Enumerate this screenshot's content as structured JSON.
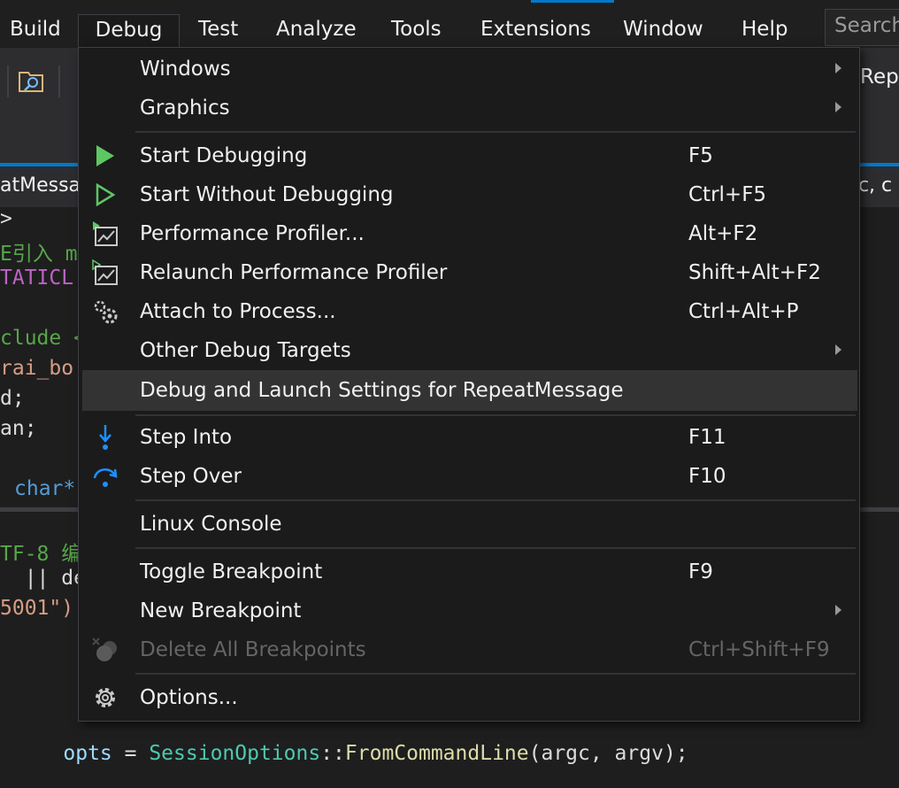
{
  "menubar": {
    "items": [
      "Build",
      "Debug",
      "Test",
      "Analyze",
      "Tools",
      "Extensions",
      "Window",
      "Help"
    ],
    "search_placeholder": "Search"
  },
  "toolbar": {
    "right_text": "Rep"
  },
  "tabs": {
    "active_label": "atMessa",
    "right_label": "gc, c"
  },
  "code": {
    "lines": [
      ">",
      "E引入 m",
      "TATICL",
      "",
      "clude <",
      "rai_bo",
      "d;",
      "an;",
      "",
      "char*"
    ],
    "lower_lines": [
      "TF-8 编",
      "  || de",
      "5001\")",
      "",
      "",
      ""
    ],
    "bottom_line": {
      "var": "opts",
      "op": " = ",
      "type": "SessionOptions",
      "sep": "::",
      "func": "FromCommandLine",
      "args": "(argc, argv);"
    }
  },
  "debug_menu": {
    "items": [
      {
        "label": "Windows",
        "shortcut": "",
        "submenu": true
      },
      {
        "label": "Graphics",
        "shortcut": "",
        "submenu": true
      },
      {
        "label": "Start Debugging",
        "shortcut": "F5",
        "icon": "play-filled-icon"
      },
      {
        "label": "Start Without Debugging",
        "shortcut": "Ctrl+F5",
        "icon": "play-outline-icon"
      },
      {
        "label": "Performance Profiler...",
        "shortcut": "Alt+F2",
        "icon": "performance-profiler-icon"
      },
      {
        "label": "Relaunch Performance Profiler",
        "shortcut": "Shift+Alt+F2",
        "icon": "relaunch-profiler-icon"
      },
      {
        "label": "Attach to Process...",
        "shortcut": "Ctrl+Alt+P",
        "icon": "gears-icon"
      },
      {
        "label": "Other Debug Targets",
        "shortcut": "",
        "submenu": true
      },
      {
        "label": "Debug and Launch Settings for RepeatMessage",
        "shortcut": ""
      },
      {
        "label": "Step Into",
        "shortcut": "F11",
        "icon": "step-into-icon"
      },
      {
        "label": "Step Over",
        "shortcut": "F10",
        "icon": "step-over-icon"
      },
      {
        "label": "Linux Console",
        "shortcut": ""
      },
      {
        "label": "Toggle Breakpoint",
        "shortcut": "F9"
      },
      {
        "label": "New Breakpoint",
        "shortcut": "",
        "submenu": true
      },
      {
        "label": "Delete All Breakpoints",
        "shortcut": "Ctrl+Shift+F9",
        "icon": "delete-breakpoints-icon",
        "disabled": true
      },
      {
        "label": "Options...",
        "shortcut": "",
        "icon": "gear-icon"
      }
    ]
  },
  "colors": {
    "accent": "#007acc",
    "play_green": "#5ec764",
    "step_blue": "#1e90ff",
    "menu_bg": "#1b1b1c",
    "highlight_bg": "#333334"
  }
}
